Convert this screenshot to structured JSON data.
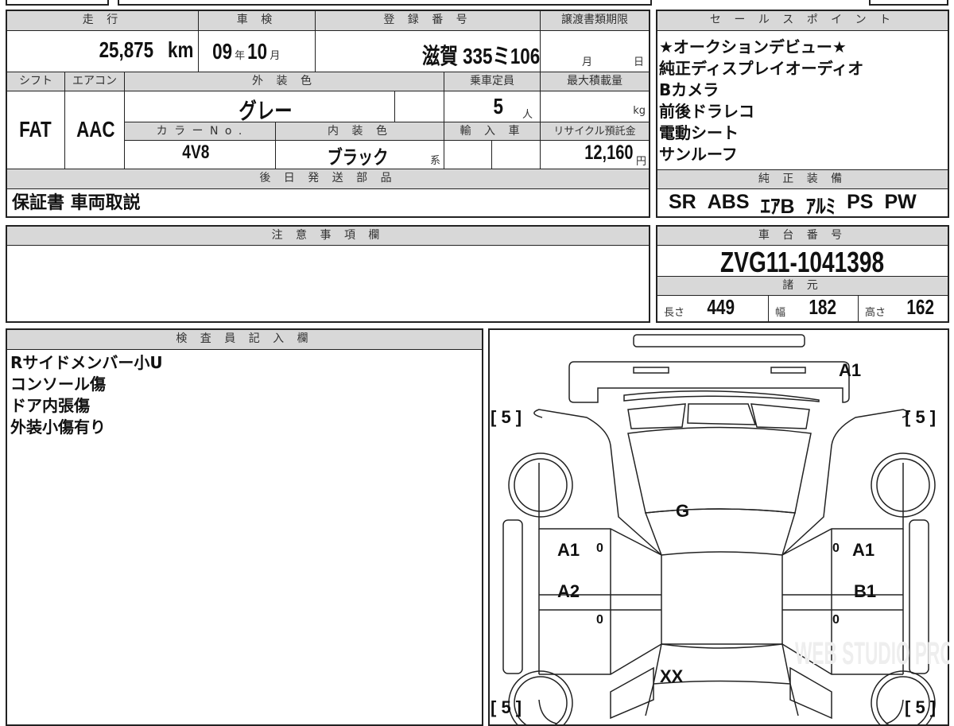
{
  "main": {
    "mileage_label": "走 行",
    "mileage": "25,875",
    "mileage_unit": "km",
    "inspection_label": "車 検",
    "inspection_year": "09",
    "year_unit": "年",
    "inspection_month": "10",
    "month_unit": "月",
    "registration_label": "登 録 番 号",
    "registration": "滋賀 335ミ106",
    "transfer_label": "譲渡書類期限",
    "transfer_month": "月",
    "transfer_day": "日",
    "shift_label": "シフト",
    "shift": "FAT",
    "ac_label": "エアコン",
    "ac": "AAC",
    "exterior_label": "外 装 色",
    "exterior": "グレー",
    "capacity_label": "乗車定員",
    "capacity": "5",
    "capacity_unit": "人",
    "max_load_label": "最大積載量",
    "max_load_unit": "kg",
    "color_no_label": "カ ラ ー N o .",
    "color_no": "4V8",
    "interior_label": "内 装 色",
    "interior": "ブラック",
    "interior_suffix": "系",
    "import_label": "輸 入 車",
    "recycle_label": "リサイクル預託金",
    "recycle": "12,160",
    "recycle_unit": "円",
    "later_parts_label": "後 日 発 送 部 品",
    "later_parts": "保証書 車両取説"
  },
  "sales": {
    "label": "セ ー ル ス ポ イ ン ト",
    "points": [
      "★オークションデビュー★",
      "純正ディスプレイオーディオ",
      "Bカメラ",
      "前後ドラレコ",
      "電動シート",
      "サンルーフ"
    ],
    "equipment_label": "純 正 装 備",
    "equipment": [
      "SR",
      "ABS",
      "ｴｱB",
      "ｱﾙﾐ",
      "PS",
      "PW"
    ]
  },
  "notes": {
    "label": "注 意 事 項 欄"
  },
  "chassis": {
    "label": "車 台 番 号",
    "number": "ZVG11-1041398",
    "spec_label": "諸 元",
    "length_label": "長さ",
    "length": "449",
    "width_label": "幅",
    "width": "182",
    "height_label": "高さ",
    "height": "162"
  },
  "inspector": {
    "label": "検 査 員 記 入 欄",
    "lines": [
      "Rサイドメンバー小U",
      "コンソール傷",
      "ドア内張傷",
      "外装小傷有り"
    ]
  },
  "diagram": {
    "front_bumper": "A1",
    "tire_fl": "[ 5 ]",
    "tire_fr": "[ 5 ]",
    "tire_rl": "[ 5 ]",
    "tire_rr": "[ 5 ]",
    "windshield": "G",
    "left_front_door": "A1",
    "left_rear_door": "A2",
    "right_front_door": "A1",
    "right_rear_door": "B1",
    "zero_lf": "0",
    "zero_lr": "0",
    "zero_rf": "0",
    "zero_rr": "0",
    "rear": "XX",
    "watermark": "WEB STUDIO PRO"
  }
}
